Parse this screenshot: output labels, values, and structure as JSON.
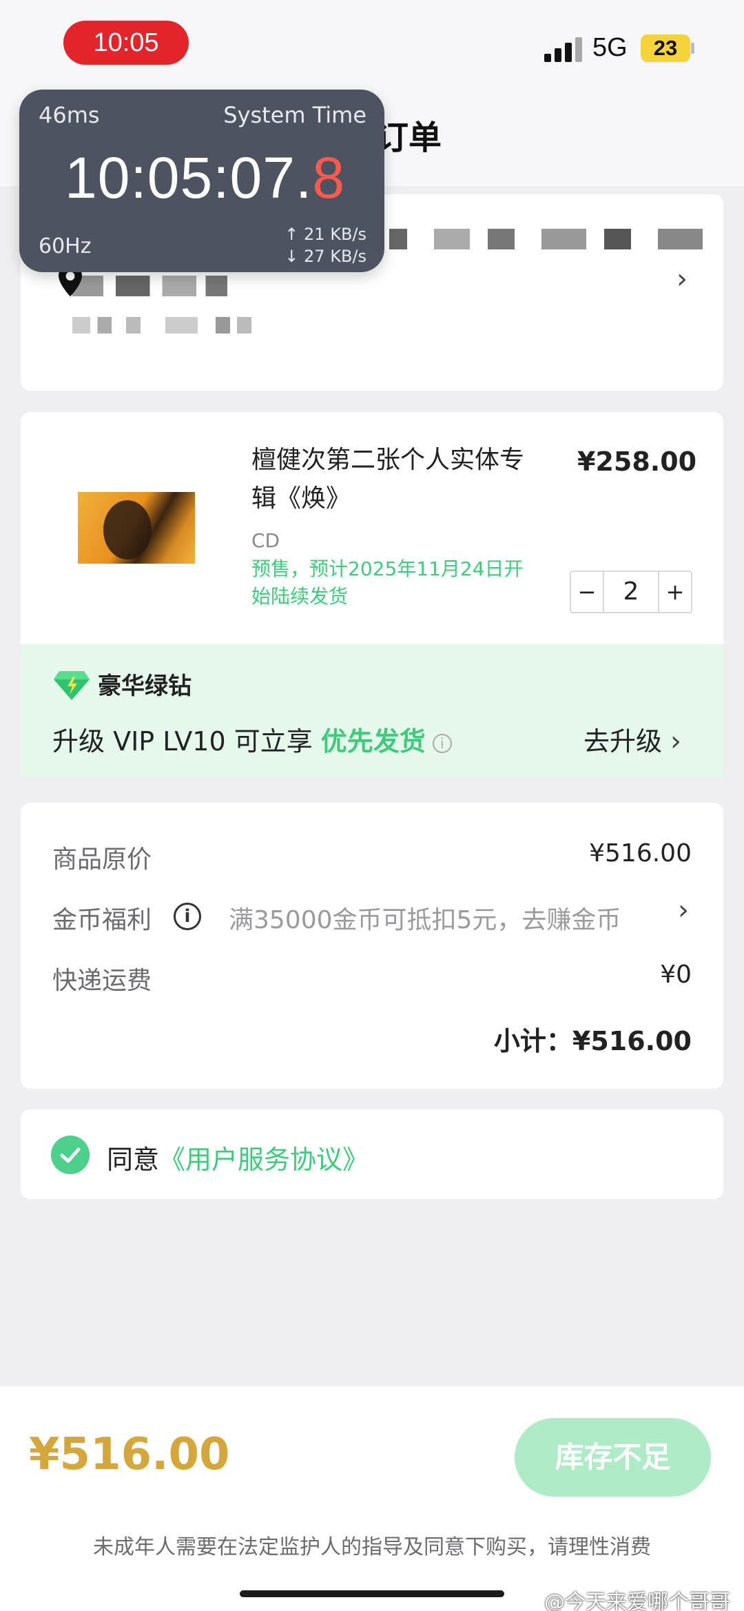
{
  "status_bar": {
    "time": "10:05",
    "network": "5G",
    "battery": "23"
  },
  "page": {
    "title_partial": "订单"
  },
  "time_widget": {
    "latency": "46ms",
    "label": "System Time",
    "clock_main": "10:05:07.",
    "clock_fraction": "8",
    "refresh_rate": "60Hz",
    "upload": "↑ 21 KB/s",
    "download": "↓ 27 KB/s"
  },
  "address": {
    "redacted": true
  },
  "product": {
    "name": "檀健次第二张个人实体专辑《焕》",
    "price": "¥258.00",
    "format": "CD",
    "presale_note": "预售，预计2025年11月24日开始陆续发货",
    "quantity": "2",
    "minus": "−",
    "plus": "+"
  },
  "vip": {
    "brand": "豪华绿钻",
    "text_prefix": "升级 VIP LV10 可立享 ",
    "highlight": "优先发货",
    "upgrade_label": "去升级",
    "accent_color": "#3ecb7c"
  },
  "pricing": {
    "original_label": "商品原价",
    "original_value": "¥516.00",
    "coin_label": "金币福利",
    "coin_note": "满35000金币可抵扣5元，去赚金币",
    "shipping_label": "快递运费",
    "shipping_value": "¥0",
    "subtotal_label": "小计：",
    "subtotal_value": "¥516.00"
  },
  "agreement": {
    "prefix": "同意",
    "link": "《用户服务协议》",
    "checked": true
  },
  "bottom": {
    "total": "¥516.00",
    "buy_button": "库存不足",
    "disclaimer": "未成年人需要在法定监护人的指导及同意下购买，请理性消费"
  },
  "watermark": "@今天来爱哪个哥哥",
  "icons": {
    "location": "map-pin-icon",
    "chevron": "chevron-right-icon",
    "gem": "diamond-icon",
    "check": "check-icon",
    "info": "info-icon"
  }
}
